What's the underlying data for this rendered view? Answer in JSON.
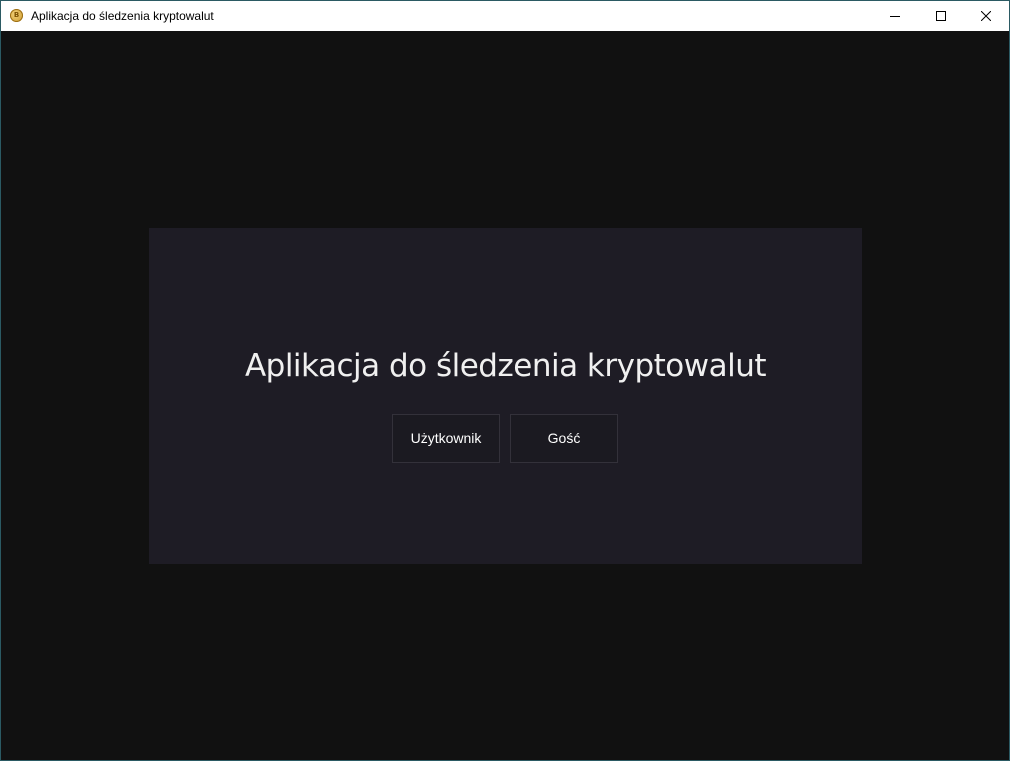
{
  "window": {
    "title": "Aplikacja do śledzenia kryptowalut",
    "icon": "bitcoin-coin-icon",
    "icon_glyph": "B",
    "controls": [
      "minimize-icon",
      "maximize-icon",
      "close-icon"
    ]
  },
  "main": {
    "heading": "Aplikacja do śledzenia kryptowalut",
    "buttons": {
      "user_label": "Użytkownik",
      "guest_label": "Gość"
    }
  },
  "colors": {
    "background": "#111111",
    "panel": "#1e1c25",
    "button": "#1b1a21",
    "button_border": "#33313a",
    "text": "#f0f0f0"
  }
}
